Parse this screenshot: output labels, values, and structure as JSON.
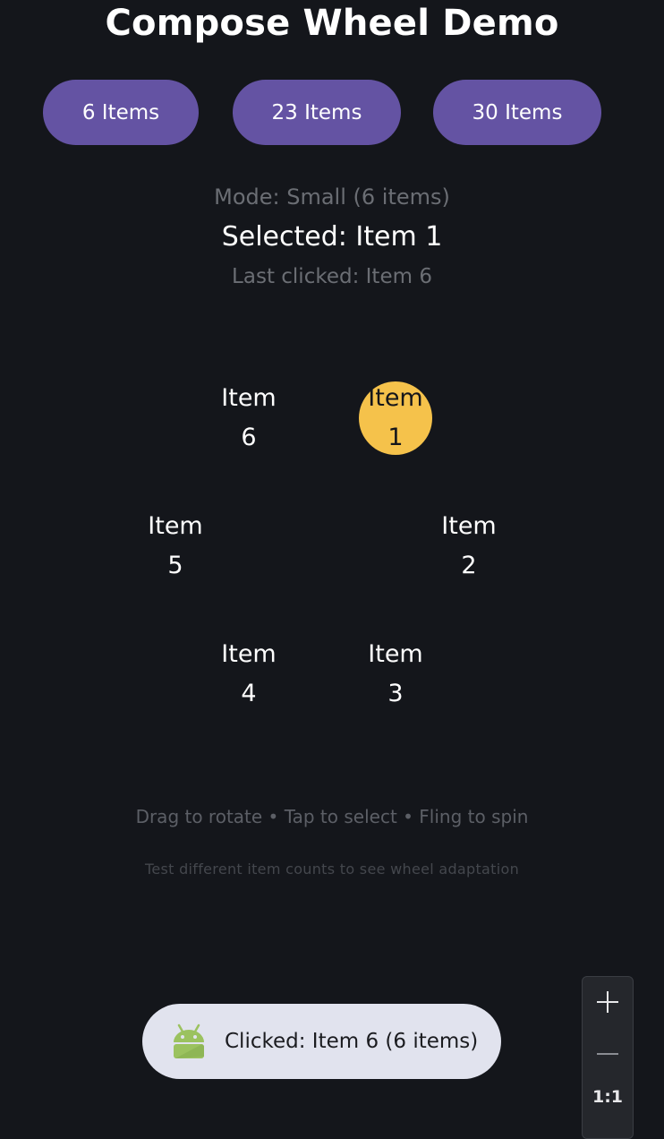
{
  "app": {
    "title": "Compose Wheel Demo"
  },
  "buttons": [
    {
      "label": "6 Items"
    },
    {
      "label": "23 Items"
    },
    {
      "label": "30 Items"
    }
  ],
  "status": {
    "mode": "Mode: Small (6 items)",
    "selected": "Selected: Item 1",
    "last_clicked": "Last clicked: Item 6"
  },
  "wheel": {
    "selected_index": 0,
    "items": [
      {
        "word": "Item",
        "number": "1"
      },
      {
        "word": "Item",
        "number": "2"
      },
      {
        "word": "Item",
        "number": "3"
      },
      {
        "word": "Item",
        "number": "4"
      },
      {
        "word": "Item",
        "number": "5"
      },
      {
        "word": "Item",
        "number": "6"
      }
    ],
    "selected_color": "#f5c24b"
  },
  "hints": {
    "line1": "Drag to rotate • Tap to select • Fling to spin",
    "line2": "Test different item counts to see wheel adaptation"
  },
  "toast": {
    "icon": "android-icon",
    "text": "Clicked: Item 6 (6 items)"
  },
  "zoom_controls": {
    "zoom_in_icon": "plus-icon",
    "zoom_out_icon": "minus-icon",
    "reset_label": "1:1"
  },
  "colors": {
    "background": "#14161b",
    "button": "#6453a3",
    "toast_bg": "#e1e3ee"
  }
}
